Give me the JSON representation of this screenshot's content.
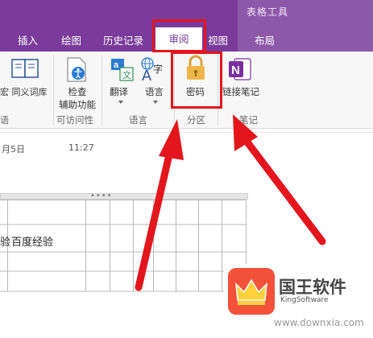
{
  "ribbon": {
    "context_group_label": "表格工具",
    "tabs": [
      {
        "label": "插入"
      },
      {
        "label": "绘图"
      },
      {
        "label": "历史记录"
      },
      {
        "label": "审阅",
        "active": true
      },
      {
        "label": "视图"
      },
      {
        "label": "布局"
      }
    ],
    "buttons": {
      "thesaurus": "同义词库",
      "accessibility_line1": "检查",
      "accessibility_line2": "辅助功能",
      "translate": "翻译",
      "language": "语言",
      "password": "密码",
      "linked_notes": "链接笔记"
    },
    "groups": {
      "proofing_partial": "语",
      "accessibility": "可访问性",
      "language": "语言",
      "section_partial": "分区",
      "notes_partial": "笔记"
    },
    "icons": {
      "translate": "translate-icon",
      "language": "language-icon",
      "password": "lock-icon",
      "linked_notes": "onenote-icon",
      "accessibility": "accessibility-check-icon",
      "thesaurus": "book-icon"
    }
  },
  "page": {
    "date_partial": "月5日",
    "time": "11:27",
    "table_cells": [
      "验",
      "百度经验"
    ]
  },
  "watermark": {
    "name": "国王软件",
    "sub": "KingSoftware",
    "url": "www.downxia.com"
  },
  "colors": {
    "accent": "#7a3b9a",
    "annotation": "#e3161d",
    "lock": "#e8a93a",
    "onenote": "#7b2f9e"
  }
}
